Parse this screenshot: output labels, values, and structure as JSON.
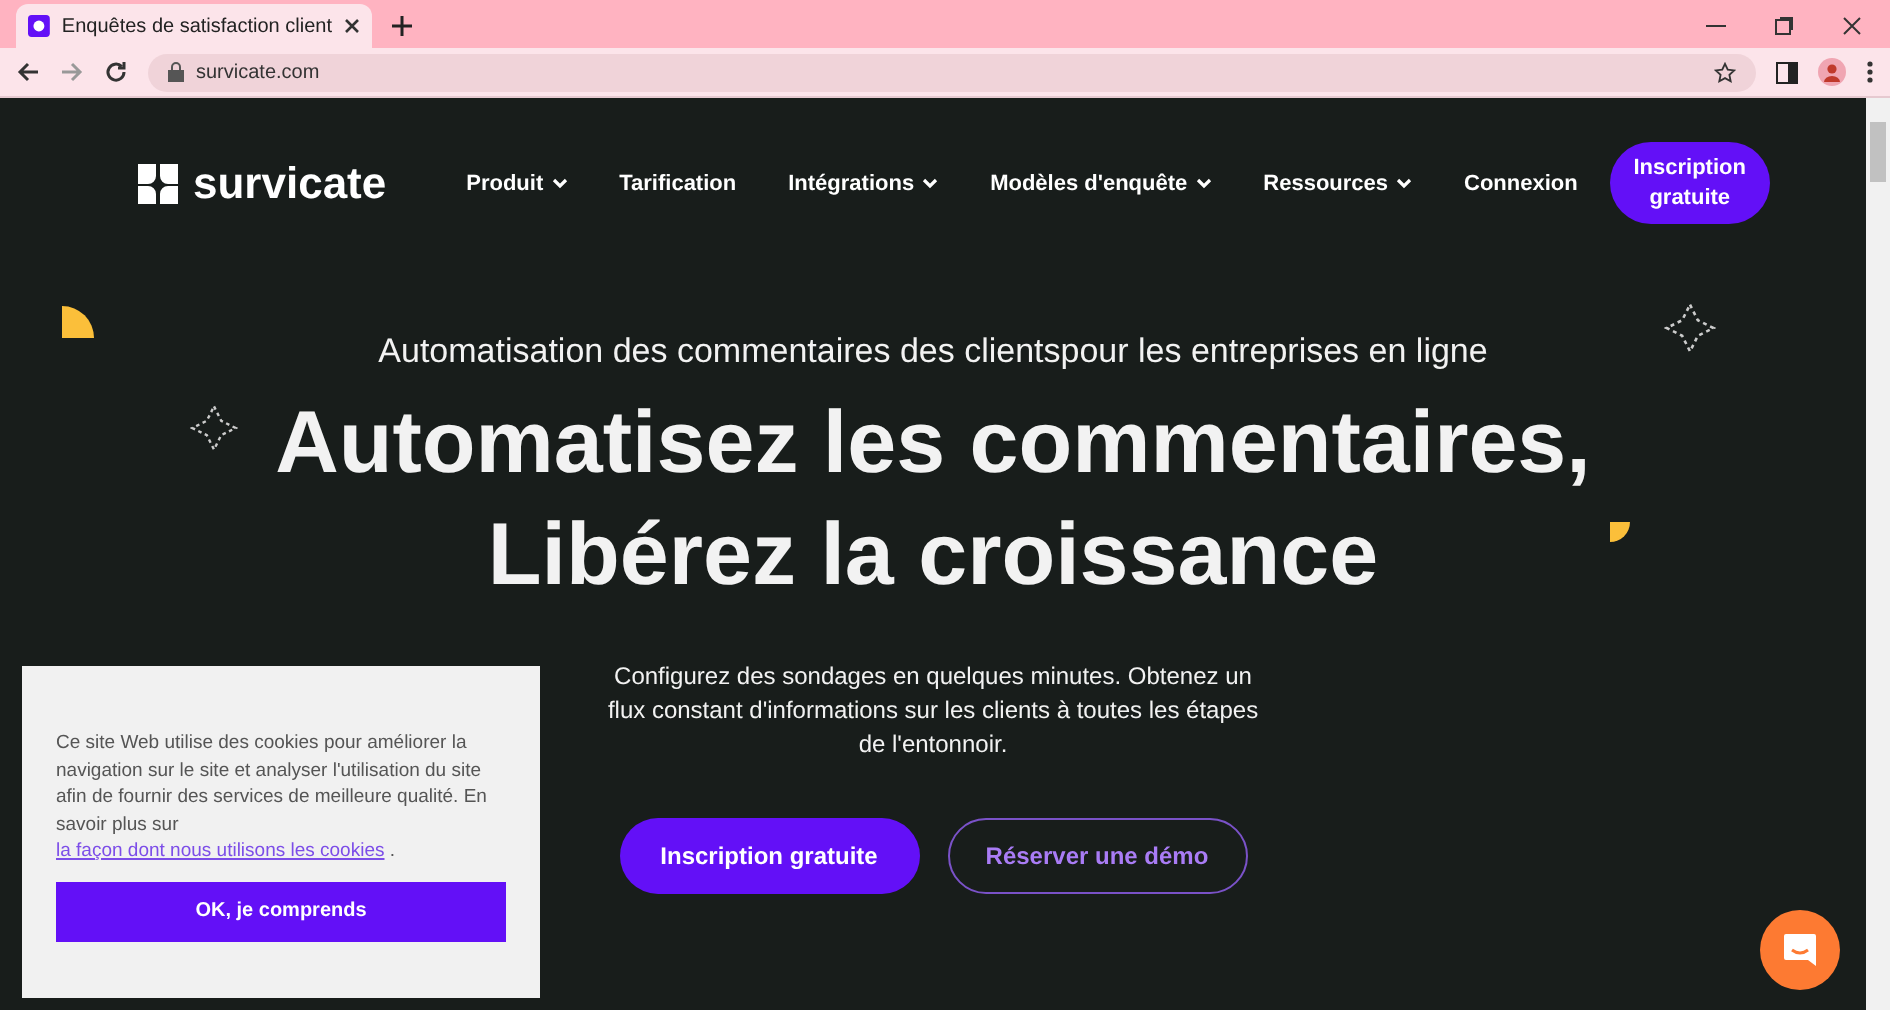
{
  "browser": {
    "tab_title": "Enquêtes de satisfaction client",
    "url": "survicate.com"
  },
  "nav": {
    "logo": "survicate",
    "items": [
      {
        "label": "Produit",
        "dropdown": true
      },
      {
        "label": "Tarification",
        "dropdown": false
      },
      {
        "label": "Intégrations",
        "dropdown": true
      },
      {
        "label": "Modèles d'enquête",
        "dropdown": true
      },
      {
        "label": "Ressources",
        "dropdown": true
      },
      {
        "label": "Connexion",
        "dropdown": false
      }
    ],
    "cta": "Inscription gratuite"
  },
  "hero": {
    "eyebrow": "Automatisation des commentaires des clientspour les entreprises en ligne",
    "title_lines": [
      "Automatisez les commentaires,",
      "Libérez la croissance"
    ],
    "subtitle": "Configurez des sondages en quelques minutes. Obtenez un flux constant d'informations sur les clients à toutes les étapes de l'entonnoir.",
    "primary_button": "Inscription gratuite",
    "secondary_button": "Réserver une démo"
  },
  "cookie_banner": {
    "text": "Ce site Web utilise des cookies pour améliorer la navigation sur le site et analyser l'utilisation du site afin de fournir des services de meilleure qualité. En savoir plus sur ",
    "link": "la façon dont nous utilisons les cookies",
    "after": " .",
    "button": "OK, je comprends"
  }
}
